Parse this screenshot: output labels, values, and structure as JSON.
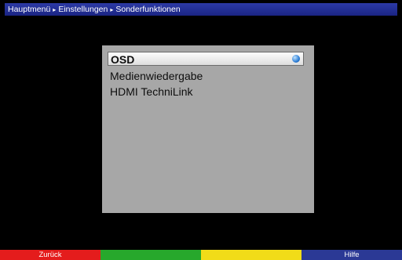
{
  "breadcrumb": {
    "items": [
      "Hauptmenü",
      "Einstellungen",
      "Sonderfunktionen"
    ],
    "separator": "▸"
  },
  "menu": {
    "items": [
      "OSD",
      "Medienwiedergabe",
      "HDMI TechniLink"
    ],
    "selected_index": 0
  },
  "buttons": {
    "red": "Zurück",
    "green": "",
    "yellow": "",
    "blue": "Hilfe"
  },
  "colors": {
    "titlebar": "#1f2b90",
    "panel": "#a7a7a7",
    "red": "#e41c1c",
    "green": "#27a82c",
    "yellow": "#f1dc18",
    "blue": "#2b3995"
  }
}
